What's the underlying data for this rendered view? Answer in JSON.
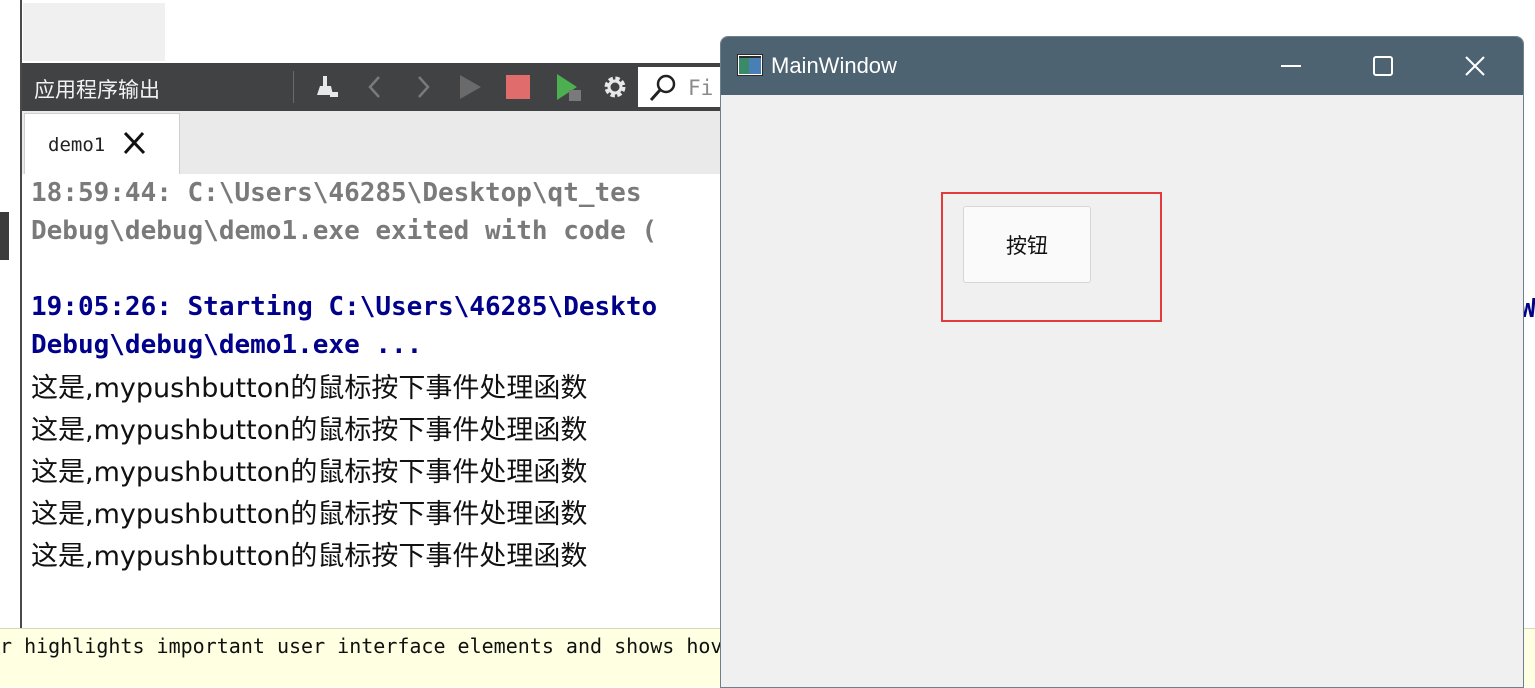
{
  "output_pane": {
    "title": "应用程序输出",
    "filter_placeholder": "Fi",
    "tab_label": "demo1"
  },
  "output_lines": [
    {
      "text": "18:59:44: C:\\Users\\46285\\Desktop\\qt_tes",
      "style": "gray"
    },
    {
      "text": "Debug\\debug\\demo1.exe exited with code (",
      "style": "gray"
    },
    {
      "text": "19:05:26: Starting C:\\Users\\46285\\Deskto",
      "style": "blue"
    },
    {
      "text": "Debug\\debug\\demo1.exe ...",
      "style": "blue"
    },
    {
      "text": "这是,mypushbutton的鼠标按下事件处理函数",
      "style": "black"
    },
    {
      "text": "这是,mypushbutton的鼠标按下事件处理函数",
      "style": "black"
    },
    {
      "text": "这是,mypushbutton的鼠标按下事件处理函数",
      "style": "black"
    },
    {
      "text": "这是,mypushbutton的鼠标按下事件处理函数",
      "style": "black"
    },
    {
      "text": "这是,mypushbutton的鼠标按下事件处理函数",
      "style": "black"
    }
  ],
  "right_edge_fragment": "W",
  "tooltip_bar": {
    "text": "r highlights important user interface elements and shows hov"
  },
  "main_window": {
    "title": "MainWindow",
    "button_label": "按钮"
  },
  "colors": {
    "toolbar_bg": "#404244",
    "titlebar_bg": "#4e6372",
    "highlight": "#e23b3b",
    "blue_text": "#00008b",
    "tooltip_bg": "#ffffe1"
  }
}
